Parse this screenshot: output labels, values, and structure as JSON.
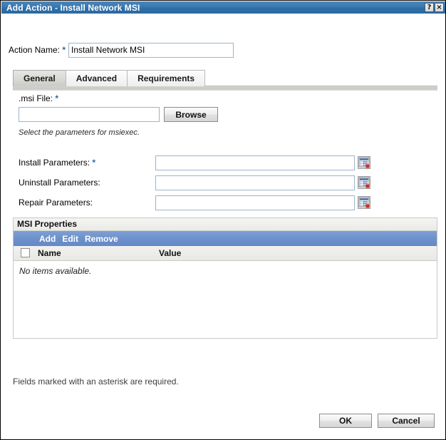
{
  "window": {
    "title": "Add Action - Install Network MSI",
    "help_button": "?",
    "close_button": "×",
    "titlebar_color": "#2f6ea7"
  },
  "form": {
    "action_name": {
      "label": "Action Name:",
      "required_marker": "*",
      "value": "Install Network MSI",
      "placeholder": ""
    }
  },
  "tabs": [
    {
      "label": "General",
      "active": true
    },
    {
      "label": "Advanced",
      "active": false
    },
    {
      "label": "Requirements",
      "active": false
    }
  ],
  "general_tab": {
    "msi_file": {
      "label": ".msi File:",
      "required_marker": "*",
      "value": "",
      "placeholder": "",
      "browse_label": "Browse"
    },
    "hint": "Select the parameters for msiexec.",
    "parameters": [
      {
        "label": "Install Parameters:",
        "required_marker": "*",
        "value": "",
        "placeholder": "",
        "picker_icon": "list-picker-icon"
      },
      {
        "label": "Uninstall Parameters:",
        "required_marker": "",
        "value": "",
        "placeholder": "",
        "picker_icon": "list-picker-icon"
      },
      {
        "label": "Repair Parameters:",
        "required_marker": "",
        "value": "",
        "placeholder": "",
        "picker_icon": "list-picker-icon"
      }
    ],
    "msi_properties": {
      "title": "MSI Properties",
      "toolbar": [
        "Add",
        "Edit",
        "Remove"
      ],
      "columns": [
        "Name",
        "Value"
      ],
      "rows": [],
      "empty_text": "No items available.",
      "toolbar_color": "#6e92cc"
    }
  },
  "footer": {
    "note": "Fields marked with an asterisk are required.",
    "ok_label": "OK",
    "cancel_label": "Cancel"
  }
}
